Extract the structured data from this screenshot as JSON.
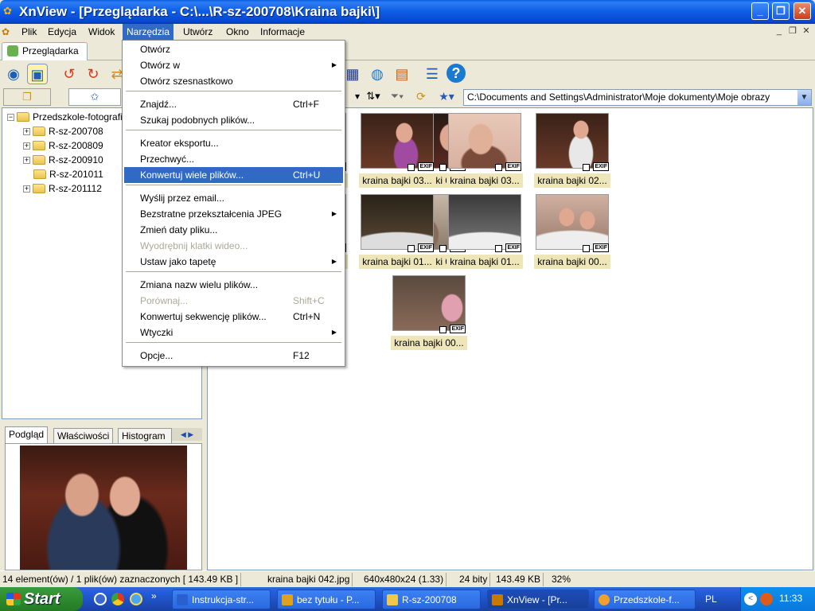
{
  "window": {
    "title": "XnView - [Przeglądarka - C:\\...\\R-sz-200708\\Kraina bajki\\]",
    "minimize": "_",
    "maximize": "❐",
    "close": "✕"
  },
  "menubar": {
    "items": [
      "Plik",
      "Edycja",
      "Widok",
      "Narzędzia",
      "Utwórz",
      "Okno",
      "Informacje"
    ],
    "active": "Narzędzia",
    "mdi": [
      "_",
      "❐",
      "✕"
    ]
  },
  "tab": {
    "label": "Przeglądarka"
  },
  "address": "C:\\Documents and Settings\\Administrator\\Moje dokumenty\\Moje obrazy",
  "tree": {
    "root": "Przedszkole-fotografie",
    "children": [
      "R-sz-200708",
      "R-sz-200809",
      "R-sz-200910",
      "R-sz-201011",
      "R-sz-201112"
    ]
  },
  "bottom_tabs": [
    "Podgląd",
    "Właściwości",
    "Histogram"
  ],
  "dropdown": {
    "items": [
      {
        "label": "Otwórz"
      },
      {
        "label": "Otwórz w",
        "sub": true
      },
      {
        "label": "Otwórz szesnastkowo"
      },
      {
        "label": "Znajdź...",
        "shortcut": "Ctrl+F"
      },
      {
        "label": "Szukaj podobnych plików..."
      },
      {
        "label": "Kreator eksportu..."
      },
      {
        "label": "Przechwyć..."
      },
      {
        "label": "Konwertuj wiele plików...",
        "shortcut": "Ctrl+U",
        "highlighted": true
      },
      {
        "label": "Wyślij przez email..."
      },
      {
        "label": "Bezstratne przekształcenia JPEG",
        "sub": true
      },
      {
        "label": "Zmień daty pliku..."
      },
      {
        "label": "Wyodrębnij klatki wideo...",
        "disabled": true
      },
      {
        "label": "Ustaw jako tapetę",
        "sub": true
      },
      {
        "label": "Zmiana nazw wielu plików..."
      },
      {
        "label": "Porównaj...",
        "shortcut": "Shift+C",
        "disabled": true
      },
      {
        "label": "Konwertuj sekwencję plików...",
        "shortcut": "Ctrl+N"
      },
      {
        "label": "Wtyczki",
        "sub": true
      },
      {
        "label": "Opcje...",
        "shortcut": "F12"
      }
    ]
  },
  "thumbnails": [
    "kraina bajki 04...",
    "kraina bajki 03...",
    "kraina bajki 03...",
    "kraina bajki 03...",
    "kraina bajki 02...",
    "kraina bajki 01...",
    "kraina bajki 01...",
    "kraina bajki 01...",
    "kraina bajki 01...",
    "kraina bajki 00...",
    "kraina bajki 00..."
  ],
  "exif_label": "EXIF",
  "status": {
    "selection": "14 element(ów) / 1 plik(ów) zaznaczonych  [ 143.49 KB ]",
    "filename": "kraina bajki 042.jpg",
    "dimensions": "640x480x24 (1.33)",
    "bits": "24 bity",
    "size": "143.49 KB",
    "zoom": "32%"
  },
  "taskbar": {
    "start": "Start",
    "tasks": [
      "Instrukcja-str...",
      "bez tytułu - P...",
      "R-sz-200708",
      "XnView - [Pr...",
      "Przedszkole-f..."
    ],
    "active_task": "XnView - [Pr...",
    "lang": "PL",
    "clock": "11:33"
  },
  "colors": {
    "accent": "#316ac5",
    "caption_bg": "#eee6b8",
    "titlebar": "#0a5fe0"
  }
}
